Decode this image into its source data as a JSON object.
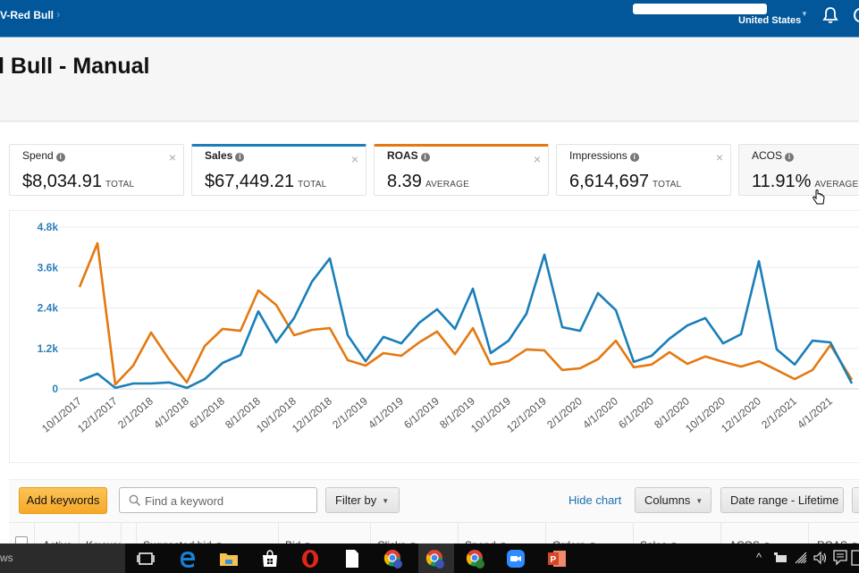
{
  "topbar": {
    "breadcrumb": "V-Red Bull",
    "breadcrumb_chevron": "›",
    "country": "United States",
    "icons": [
      "bell-icon",
      "help-icon"
    ]
  },
  "page": {
    "title": "l Bull - Manual"
  },
  "metrics": [
    {
      "label": "Spend",
      "value": "$8,034.91",
      "unit": "TOTAL",
      "selected": false
    },
    {
      "label": "Sales",
      "value": "$67,449.21",
      "unit": "TOTAL",
      "selected": true,
      "color": "#1a7fb8"
    },
    {
      "label": "ROAS",
      "value": "8.39",
      "unit": "AVERAGE",
      "selected": true,
      "color": "#e47911"
    },
    {
      "label": "Impressions",
      "value": "6,614,697",
      "unit": "TOTAL",
      "selected": false
    },
    {
      "label": "ACOS",
      "value": "11.91%",
      "unit": "AVERAGE",
      "selected": false
    }
  ],
  "close_glyph": "×",
  "info_glyph": "i",
  "chart_data": {
    "type": "line",
    "title": "",
    "xlabel": "",
    "ylabel": "",
    "ylim": [
      0,
      4800
    ],
    "yticks": [
      "0",
      "1.2k",
      "2.4k",
      "3.6k",
      "4.8k"
    ],
    "ytick_values": [
      0,
      1200,
      2400,
      3600,
      4800
    ],
    "xticks": [
      "10/1/2017",
      "12/1/2017",
      "2/1/2018",
      "4/1/2018",
      "6/1/2018",
      "8/1/2018",
      "10/1/2018",
      "12/1/2018",
      "2/1/2019",
      "4/1/2019",
      "6/1/2019",
      "8/1/2019",
      "10/1/2019",
      "12/1/2019",
      "2/1/2020",
      "4/1/2020",
      "6/1/2020",
      "8/1/2020",
      "10/1/2020",
      "12/1/2020",
      "2/1/2021",
      "4/1/2021"
    ],
    "x": [
      "10/1/2017",
      "11/1/2017",
      "12/1/2017",
      "1/1/2018",
      "2/1/2018",
      "3/1/2018",
      "4/1/2018",
      "5/1/2018",
      "6/1/2018",
      "7/1/2018",
      "8/1/2018",
      "9/1/2018",
      "10/1/2018",
      "11/1/2018",
      "12/1/2018",
      "1/1/2019",
      "2/1/2019",
      "3/1/2019",
      "4/1/2019",
      "5/1/2019",
      "6/1/2019",
      "7/1/2019",
      "8/1/2019",
      "9/1/2019",
      "10/1/2019",
      "11/1/2019",
      "12/1/2019",
      "1/1/2020",
      "2/1/2020",
      "3/1/2020",
      "4/1/2020",
      "5/1/2020",
      "6/1/2020",
      "7/1/2020",
      "8/1/2020",
      "9/1/2020",
      "10/1/2020",
      "11/1/2020",
      "12/1/2020",
      "1/1/2021",
      "2/1/2021",
      "3/1/2021",
      "4/1/2021",
      "5/1/2021"
    ],
    "grid": true,
    "legend": "none",
    "series": [
      {
        "name": "Sales",
        "color": "#1a7fb8",
        "values": [
          240,
          450,
          30,
          160,
          160,
          190,
          30,
          290,
          770,
          1000,
          2300,
          1380,
          2100,
          3180,
          3870,
          1590,
          820,
          1540,
          1350,
          1960,
          2360,
          1780,
          2970,
          1060,
          1430,
          2230,
          3980,
          1830,
          1720,
          2840,
          2330,
          800,
          980,
          1490,
          1880,
          2100,
          1350,
          1620,
          3790,
          1170,
          720,
          1430,
          1380,
          160
        ]
      },
      {
        "name": "ROAS",
        "color": "#e47911",
        "values": [
          3020,
          4320,
          130,
          690,
          1670,
          880,
          190,
          1270,
          1780,
          1720,
          2920,
          2490,
          1590,
          1750,
          1800,
          850,
          690,
          1060,
          980,
          1380,
          1700,
          1030,
          1800,
          720,
          820,
          1170,
          1140,
          560,
          610,
          880,
          1430,
          640,
          720,
          1090,
          740,
          960,
          800,
          660,
          820,
          560,
          290,
          560,
          1300,
          270
        ]
      }
    ]
  },
  "toolbar": {
    "add_keywords": "Add keywords",
    "search_placeholder": "Find a keyword",
    "search_value": "",
    "filter_by": "Filter by",
    "hide_chart": "Hide chart",
    "columns": "Columns",
    "date_range": "Date range - Lifetime"
  },
  "table": {
    "columns": [
      "Active",
      "Keywor",
      "Suggested bid",
      "Bid",
      "Clicks",
      "Spend",
      "Orders",
      "Sales",
      "ACOS",
      "ROAS"
    ]
  },
  "taskbar": {
    "search_text": "ws",
    "apps": [
      "task-view",
      "edge",
      "file-explorer",
      "store",
      "opera",
      "notepad",
      "chrome-profile-u",
      "chrome-profile-u-active",
      "chrome-profile-u-green",
      "zoom",
      "powerpoint"
    ],
    "tray": [
      "chevron-up",
      "battery",
      "wifi",
      "volume",
      "notifications"
    ]
  }
}
